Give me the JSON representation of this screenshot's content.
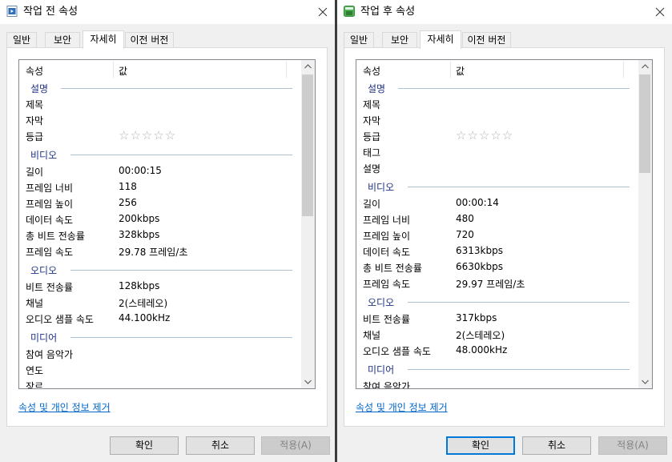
{
  "common": {
    "tabs": [
      "일반",
      "보안",
      "자세히",
      "이전 버전"
    ],
    "columns": {
      "property": "속성",
      "value": "값"
    },
    "remove_link": "속성 및 개인 정보 제거",
    "buttons": {
      "ok": "확인",
      "cancel": "취소",
      "apply": "적용(A)"
    },
    "stars": "☆☆☆☆☆"
  },
  "left": {
    "title": "작업 전 속성",
    "groups": {
      "description": "설명",
      "video": "비디오",
      "audio": "오디오",
      "media": "미디어"
    },
    "rows": {
      "title": {
        "label": "제목",
        "value": ""
      },
      "subtitle": {
        "label": "자막",
        "value": ""
      },
      "rating": {
        "label": "등급"
      },
      "length": {
        "label": "길이",
        "value": "00:00:15"
      },
      "frame_width": {
        "label": "프레임 너비",
        "value": "118"
      },
      "frame_height": {
        "label": "프레임 높이",
        "value": "256"
      },
      "data_rate": {
        "label": "데이터 속도",
        "value": "200kbps"
      },
      "total_bitrate": {
        "label": "총 비트 전송률",
        "value": "328kbps"
      },
      "frame_rate": {
        "label": "프레임 속도",
        "value": "29.78 프레임/초"
      },
      "bitrate": {
        "label": "비트 전송률",
        "value": "128kbps"
      },
      "channels": {
        "label": "채널",
        "value": "2(스테레오)"
      },
      "sample_rate": {
        "label": "오디오 샘플 속도",
        "value": "44.100kHz"
      },
      "contributing_artist": {
        "label": "참여 음악가",
        "value": ""
      },
      "year": {
        "label": "연도",
        "value": ""
      },
      "genre": {
        "label": "장르",
        "value": ""
      }
    }
  },
  "right": {
    "title": "작업 후 속성",
    "groups": {
      "description": "설명",
      "video": "비디오",
      "audio": "오디오",
      "media": "미디어"
    },
    "rows": {
      "title": {
        "label": "제목",
        "value": ""
      },
      "subtitle": {
        "label": "자막",
        "value": ""
      },
      "rating": {
        "label": "등급"
      },
      "tags": {
        "label": "태그",
        "value": ""
      },
      "comments": {
        "label": "설명",
        "value": ""
      },
      "length": {
        "label": "길이",
        "value": "00:00:14"
      },
      "frame_width": {
        "label": "프레임 너비",
        "value": "480"
      },
      "frame_height": {
        "label": "프레임 높이",
        "value": "720"
      },
      "data_rate": {
        "label": "데이터 속도",
        "value": "6313kbps"
      },
      "total_bitrate": {
        "label": "총 비트 전송률",
        "value": "6630kbps"
      },
      "frame_rate": {
        "label": "프레임 속도",
        "value": "29.97 프레임/초"
      },
      "bitrate": {
        "label": "비트 전송률",
        "value": "317kbps"
      },
      "channels": {
        "label": "채널",
        "value": "2(스테레오)"
      },
      "sample_rate": {
        "label": "오디오 샘플 속도",
        "value": "48.000kHz"
      },
      "contributing_artist": {
        "label": "참여 음악가",
        "value": ""
      }
    }
  },
  "colors": {
    "link": "#0066cc",
    "group_label": "#1e3287",
    "accent": "#0078d7"
  },
  "icons": {
    "left_title": "video-file-icon",
    "right_title": "mp4-file-icon",
    "close": "close-icon"
  }
}
